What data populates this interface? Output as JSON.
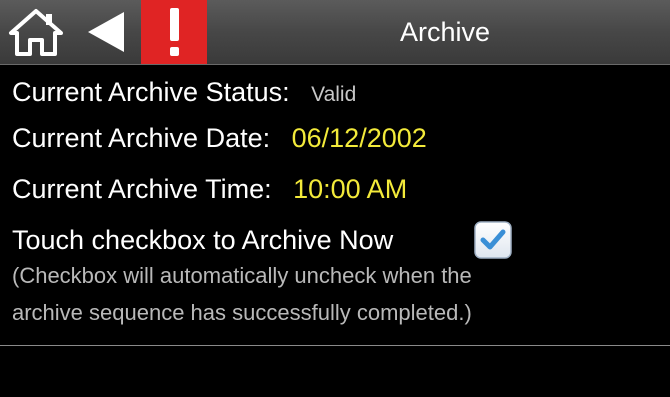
{
  "header": {
    "title": "Archive",
    "home_icon": "home-icon",
    "back_icon": "back-arrow-icon",
    "alarm_icon": "exclamation-icon",
    "alarm_color": "#e02424"
  },
  "archive": {
    "status_label": "Current Archive Status:",
    "status_value": "Valid",
    "date_label": "Current Archive Date:",
    "date_value": "06/12/2002",
    "time_label": "Current Archive Time:",
    "time_value": "10:00 AM",
    "archive_now_label": "Touch checkbox to Archive Now",
    "archive_now_checked": true,
    "note_line1": "(Checkbox will automatically uncheck when the",
    "note_line2": "archive sequence has successfully completed.)"
  },
  "colors": {
    "value_highlight": "#f3ea3a",
    "checkbox_accent": "#3a8fd6"
  }
}
